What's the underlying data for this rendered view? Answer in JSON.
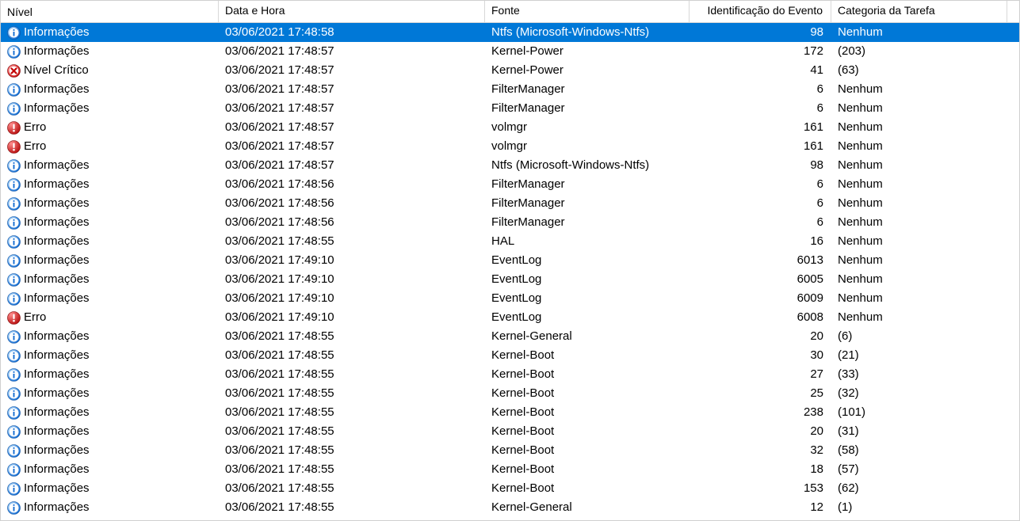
{
  "columns": {
    "level": "Nível",
    "date": "Data e Hora",
    "source": "Fonte",
    "id": "Identificação do Evento",
    "category": "Categoria da Tarefa"
  },
  "rows": [
    {
      "icon": "info",
      "level": "Informações",
      "date": "03/06/2021 17:48:58",
      "source": "Ntfs (Microsoft-Windows-Ntfs)",
      "id": "98",
      "category": "Nenhum",
      "selected": true
    },
    {
      "icon": "info",
      "level": "Informações",
      "date": "03/06/2021 17:48:57",
      "source": "Kernel-Power",
      "id": "172",
      "category": "(203)"
    },
    {
      "icon": "critical",
      "level": "Nível Crítico",
      "date": "03/06/2021 17:48:57",
      "source": "Kernel-Power",
      "id": "41",
      "category": "(63)"
    },
    {
      "icon": "info",
      "level": "Informações",
      "date": "03/06/2021 17:48:57",
      "source": "FilterManager",
      "id": "6",
      "category": "Nenhum"
    },
    {
      "icon": "info",
      "level": "Informações",
      "date": "03/06/2021 17:48:57",
      "source": "FilterManager",
      "id": "6",
      "category": "Nenhum"
    },
    {
      "icon": "error",
      "level": "Erro",
      "date": "03/06/2021 17:48:57",
      "source": "volmgr",
      "id": "161",
      "category": "Nenhum"
    },
    {
      "icon": "error",
      "level": "Erro",
      "date": "03/06/2021 17:48:57",
      "source": "volmgr",
      "id": "161",
      "category": "Nenhum"
    },
    {
      "icon": "info",
      "level": "Informações",
      "date": "03/06/2021 17:48:57",
      "source": "Ntfs (Microsoft-Windows-Ntfs)",
      "id": "98",
      "category": "Nenhum"
    },
    {
      "icon": "info",
      "level": "Informações",
      "date": "03/06/2021 17:48:56",
      "source": "FilterManager",
      "id": "6",
      "category": "Nenhum"
    },
    {
      "icon": "info",
      "level": "Informações",
      "date": "03/06/2021 17:48:56",
      "source": "FilterManager",
      "id": "6",
      "category": "Nenhum"
    },
    {
      "icon": "info",
      "level": "Informações",
      "date": "03/06/2021 17:48:56",
      "source": "FilterManager",
      "id": "6",
      "category": "Nenhum"
    },
    {
      "icon": "info",
      "level": "Informações",
      "date": "03/06/2021 17:48:55",
      "source": "HAL",
      "id": "16",
      "category": "Nenhum"
    },
    {
      "icon": "info",
      "level": "Informações",
      "date": "03/06/2021 17:49:10",
      "source": "EventLog",
      "id": "6013",
      "category": "Nenhum"
    },
    {
      "icon": "info",
      "level": "Informações",
      "date": "03/06/2021 17:49:10",
      "source": "EventLog",
      "id": "6005",
      "category": "Nenhum"
    },
    {
      "icon": "info",
      "level": "Informações",
      "date": "03/06/2021 17:49:10",
      "source": "EventLog",
      "id": "6009",
      "category": "Nenhum"
    },
    {
      "icon": "error",
      "level": "Erro",
      "date": "03/06/2021 17:49:10",
      "source": "EventLog",
      "id": "6008",
      "category": "Nenhum"
    },
    {
      "icon": "info",
      "level": "Informações",
      "date": "03/06/2021 17:48:55",
      "source": "Kernel-General",
      "id": "20",
      "category": "(6)"
    },
    {
      "icon": "info",
      "level": "Informações",
      "date": "03/06/2021 17:48:55",
      "source": "Kernel-Boot",
      "id": "30",
      "category": "(21)"
    },
    {
      "icon": "info",
      "level": "Informações",
      "date": "03/06/2021 17:48:55",
      "source": "Kernel-Boot",
      "id": "27",
      "category": "(33)"
    },
    {
      "icon": "info",
      "level": "Informações",
      "date": "03/06/2021 17:48:55",
      "source": "Kernel-Boot",
      "id": "25",
      "category": "(32)"
    },
    {
      "icon": "info",
      "level": "Informações",
      "date": "03/06/2021 17:48:55",
      "source": "Kernel-Boot",
      "id": "238",
      "category": "(101)"
    },
    {
      "icon": "info",
      "level": "Informações",
      "date": "03/06/2021 17:48:55",
      "source": "Kernel-Boot",
      "id": "20",
      "category": "(31)"
    },
    {
      "icon": "info",
      "level": "Informações",
      "date": "03/06/2021 17:48:55",
      "source": "Kernel-Boot",
      "id": "32",
      "category": "(58)"
    },
    {
      "icon": "info",
      "level": "Informações",
      "date": "03/06/2021 17:48:55",
      "source": "Kernel-Boot",
      "id": "18",
      "category": "(57)"
    },
    {
      "icon": "info",
      "level": "Informações",
      "date": "03/06/2021 17:48:55",
      "source": "Kernel-Boot",
      "id": "153",
      "category": "(62)"
    },
    {
      "icon": "info",
      "level": "Informações",
      "date": "03/06/2021 17:48:55",
      "source": "Kernel-General",
      "id": "12",
      "category": "(1)"
    }
  ]
}
